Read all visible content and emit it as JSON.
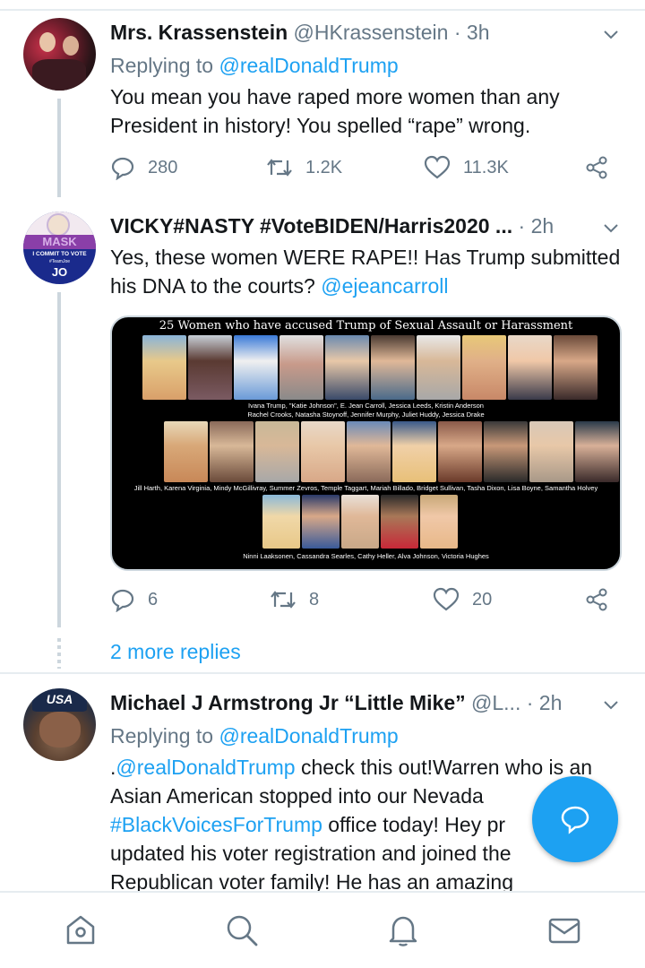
{
  "tweets": [
    {
      "name": "Mrs. Krassenstein",
      "handle": "@HKrassenstein",
      "time": "3h",
      "replying_prefix": "Replying to ",
      "replying_to": "@realDonaldTrump",
      "text": "You mean you have raped more women than any President in history!  You spelled “rape” wrong.",
      "replies": "280",
      "retweets": "1.2K",
      "likes": "11.3K"
    },
    {
      "name": "VICKY#NASTY #VoteBIDEN/Harris2020 ...",
      "time": "2h",
      "text": "Yes, these women WERE RAPE!! Has Trump submitted his DNA to the courts? ",
      "mention": "@ejeancarroll",
      "replies": "6",
      "retweets": "8",
      "likes": "20",
      "avatar_text": {
        "mask": "MASK",
        "commit": "I COMMIT TO VOTE",
        "tag": "#TeamJoe",
        "jo": "JO"
      },
      "media": {
        "title": "25 Women who have accused Trump of Sexual Assault or Harassment",
        "caption1a": "Ivana Trump, \"Katie Johnson\", E. Jean Carroll, Jessica Leeds, Kristin Anderson",
        "caption1b": "Rachel Crooks, Natasha Stoynoff, Jennifer Murphy, Juliet Huddy, Jessica Drake",
        "caption2": "Jill Harth, Karena Virginia, Mindy McGillivray, Summer Zevros, Temple Taggart, Mariah Billado, Bridget Sullivan, Tasha Dixon, Lisa Boyne, Samantha Holvey",
        "caption3": "Ninni Laaksonen, Cassandra Searles, Cathy Heller, Alva Johnson, Victoria Hughes"
      },
      "more_replies": "2 more replies"
    },
    {
      "name": "Michael J Armstrong Jr “Little Mike”",
      "handle": "@L...",
      "time": "2h",
      "replying_prefix": "Replying to ",
      "replying_to": "@realDonaldTrump",
      "line1_prefix": ".",
      "line1_mention": "@realDonaldTrump",
      "line1_rest": " check this out!Warren who is an",
      "line2": "Asian American stopped into our Nevada",
      "line3_hashtag": "#BlackVoicesForTrump",
      "line3_rest": " office today! Hey pr",
      "line4": "updated his voter registration and joined the",
      "line5": "Republican voter family! He has an amazing",
      "avatar_text": "USA"
    }
  ],
  "colors": {
    "accent": "#1da1f2",
    "muted": "#657786",
    "text": "#14171a",
    "border": "#e6ecf0"
  },
  "nav": {
    "items": [
      "home-icon",
      "search-icon",
      "notifications-icon",
      "messages-icon"
    ]
  },
  "fab_icon": "compose-reply-icon"
}
